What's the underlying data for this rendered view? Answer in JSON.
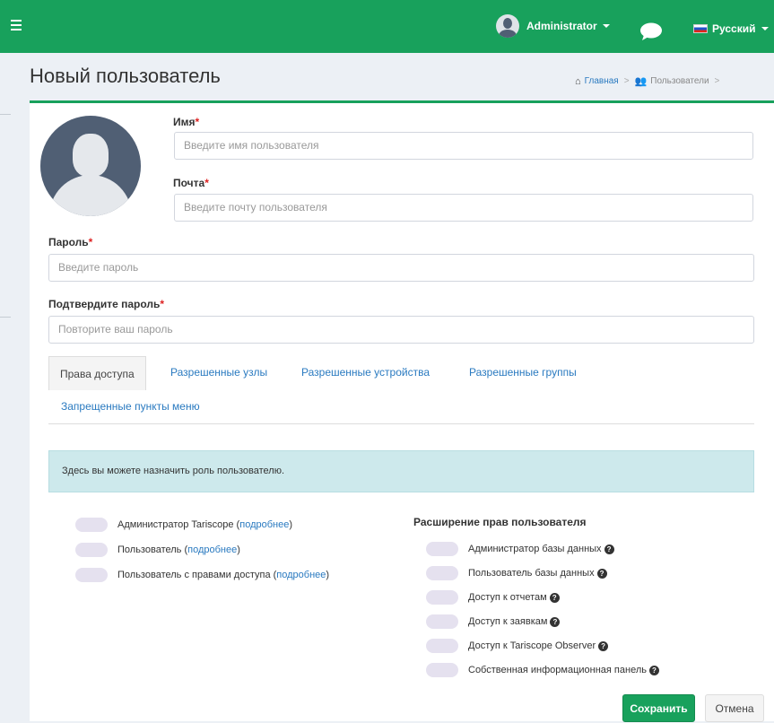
{
  "topbar": {
    "menu_icon": "hamburger-icon",
    "user_name": "Administrator",
    "chat_icon": "chat-bubble-icon",
    "language": "Русский",
    "brand_color": "#18a15c"
  },
  "page": {
    "title": "Новый пользователь",
    "breadcrumb": [
      "Главная",
      "Пользователи"
    ]
  },
  "form": {
    "name_label": "Имя",
    "name_placeholder": "Введите имя пользователя",
    "email_label": "Почта",
    "email_placeholder": "Введите почту пользователя",
    "password_label": "Пароль",
    "password_placeholder": "Введите пароль",
    "confirm_label": "Подтвердите пароль",
    "confirm_placeholder": "Повторите ваш пароль",
    "required_mark": "*"
  },
  "tabs": [
    "Права доступа",
    "Разрешенные узлы",
    "Разрешенные устройства",
    "Разрешенные группы",
    "Запрещенные пункты меню"
  ],
  "info_text": "Здесь вы можете назначить роль пользователю.",
  "roles": [
    {
      "label": "Администратор Tariscope",
      "more": "подробнее"
    },
    {
      "label": "Пользователь",
      "more": "подробнее"
    },
    {
      "label": "Пользователь с правами доступа",
      "more": "подробнее"
    }
  ],
  "extensions": {
    "title": "Расширение прав пользователя",
    "items": [
      "Администратор базы данных",
      "Пользователь базы данных",
      "Доступ к отчетам",
      "Доступ к заявкам",
      "Доступ к Tariscope Observer",
      "Собственная информационная панель"
    ]
  },
  "buttons": {
    "save": "Сохранить",
    "cancel": "Отмена"
  }
}
